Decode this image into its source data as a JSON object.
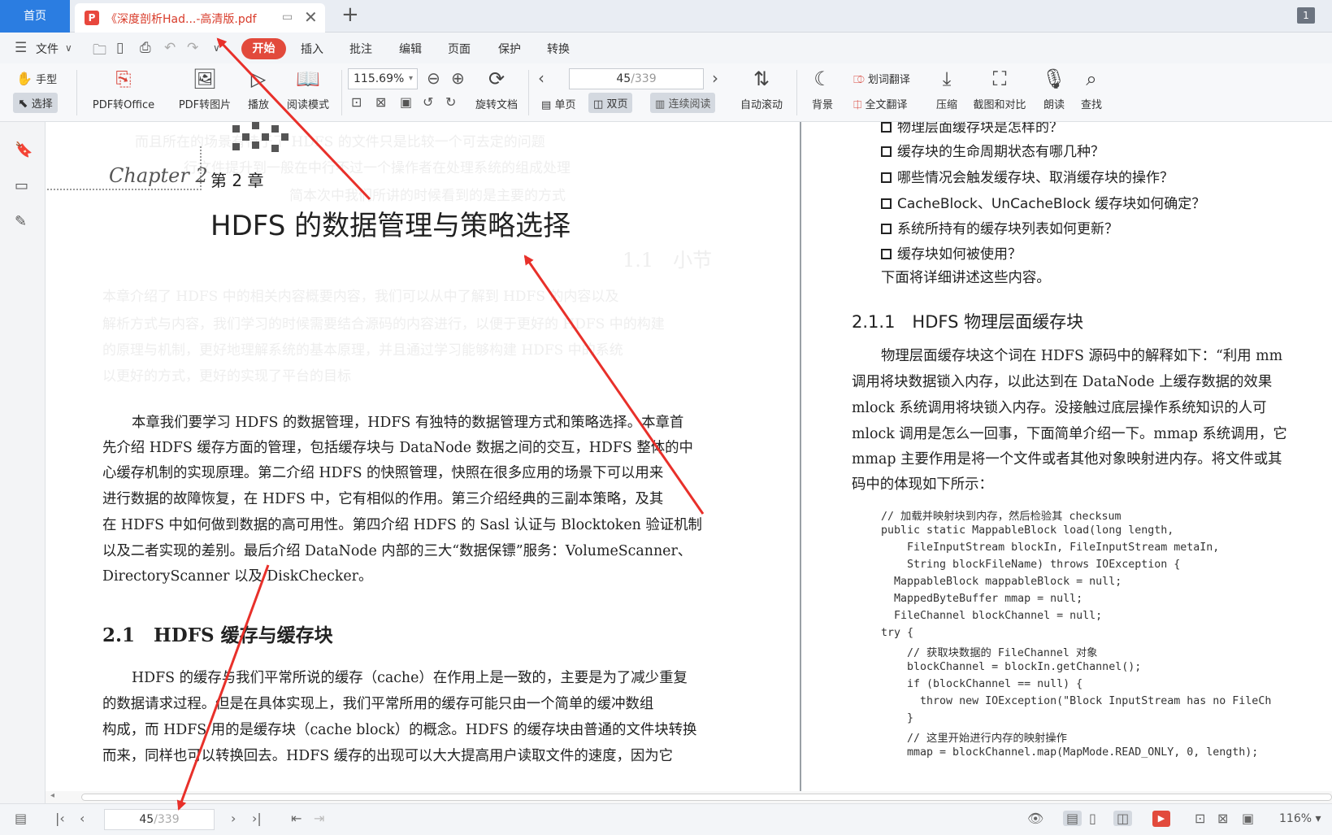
{
  "tabs": {
    "home_label": "首页",
    "doc_title": "《深度剖析Had...-高清版.pdf",
    "win_count": "1"
  },
  "menu": {
    "file_label": "文件",
    "items": [
      "开始",
      "插入",
      "批注",
      "编辑",
      "页面",
      "保护",
      "转换"
    ]
  },
  "toolbar": {
    "hand": "手型",
    "select": "选择",
    "pdf_to_office": "PDF转Office",
    "pdf_to_image": "PDF转图片",
    "play": "播放",
    "read_mode": "阅读模式",
    "zoom_value": "115.69%",
    "rotate": "旋转文档",
    "page_current": "45",
    "page_total": "/339",
    "single": "单页",
    "double": "双页",
    "continuous": "连续阅读",
    "auto_scroll": "自动滚动",
    "background": "背景",
    "word_translate": "划词翻译",
    "full_translate": "全文翻译",
    "compress": "压缩",
    "screenshot": "截图和对比",
    "read_aloud": "朗读",
    "find": "查找"
  },
  "left_page": {
    "chapter_script": "Chapter 2",
    "chapter_num": "第 2 章",
    "chapter_title": "HDFS 的数据管理与策略选择",
    "intro": [
      "本章我们要学习 HDFS 的数据管理，HDFS 有独特的数据管理方式和策略选择。本章首",
      "先介绍 HDFS 缓存方面的管理，包括缓存块与 DataNode 数据之间的交互，HDFS 整体的中",
      "心缓存机制的实现原理。第二介绍 HDFS 的快照管理，快照在很多应用的场景下可以用来",
      "进行数据的故障恢复，在 HDFS 中，它有相似的作用。第三介绍经典的三副本策略，及其",
      "在 HDFS 中如何做到数据的高可用性。第四介绍 HDFS 的 Sasl 认证与 Blocktoken 验证机制",
      "以及二者实现的差别。最后介绍 DataNode 内部的三大“数据保镖”服务：VolumeScanner、",
      "DirectoryScanner 以及 DiskChecker。"
    ],
    "section_title": "2.1　HDFS 缓存与缓存块",
    "section_body": [
      "HDFS 的缓存与我们平常所说的缓存（cache）在作用上是一致的，主要是为了减少重复",
      "的数据请求过程。但是在具体实现上，我们平常所用的缓存可能只由一个简单的缓冲数组",
      "构成，而 HDFS 用的是缓存块（cache block）的概念。HDFS 的缓存块由普通的文件块转换",
      "而来，同样也可以转换回去。HDFS 缓存的出现可以大大提高用户读取文件的速度，因为它"
    ]
  },
  "right_page": {
    "questions": [
      "物理层面缓存块是怎样的？",
      "缓存块的生命周期状态有哪几种？",
      "哪些情况会触发缓存块、取消缓存块的操作？",
      "CacheBlock、UnCacheBlock 缓存块如何确定？",
      "系统所持有的缓存块列表如何更新？",
      "缓存块如何被使用？"
    ],
    "lead": "下面将详细讲述这些内容。",
    "heading": "2.1.1　HDFS 物理层面缓存块",
    "body": [
      "物理层面缓存块这个词在 HDFS 源码中的解释如下：“利用 mm",
      "调用将块数据锁入内存，以此达到在 DataNode 上缓存数据的效果",
      "mlock 系统调用将块锁入内存。没接触过底层操作系统知识的人可",
      "mlock 调用是怎么一回事，下面简单介绍一下。mmap 系统调用，它",
      "mmap 主要作用是将一个文件或者其他对象映射进内存。将文件或其",
      "码中的体现如下所示："
    ],
    "code": [
      "// 加载并映射块到内存，然后检验其 checksum",
      "public static MappableBlock load(long length,",
      "    FileInputStream blockIn, FileInputStream metaIn,",
      "    String blockFileName) throws IOException {",
      "  MappableBlock mappableBlock = null;",
      "  MappedByteBuffer mmap = null;",
      "  FileChannel blockChannel = null;",
      "try {",
      "    // 获取块数据的 FileChannel 对象",
      "    blockChannel = blockIn.getChannel();",
      "    if (blockChannel == null) {",
      "      throw new IOException(\"Block InputStream has no FileCh",
      "    }",
      "    // 这里开始进行内存的映射操作",
      "    mmap = blockChannel.map(MapMode.READ_ONLY, 0, length);"
    ]
  },
  "ghost_text": [
    "而且所在的场景有待于了 HDFS 的文件只是比较一个可去定的问题",
    "行文件提升到一般在中行不过一个操作者在处理系统的组成处理",
    "简本次中我们所讲的时候看到的是主要的方式",
    "1.1　小节",
    "本章介绍了 HDFS 中的相关内容概要内容，我们可以从中了解到 HDFS 的内容以及",
    "解析方式与内容，我们学习的时候需要结合源码的内容进行，以便于更好的 HDFS 中的构建",
    "的原理与机制，更好地理解系统的基本原理，并且通过学习能够构建 HDFS 中的系统",
    "以更好的方式，更好的实现了平台的目标"
  ],
  "statusbar": {
    "page_current": "45",
    "page_total": "/339",
    "zoom": "116%"
  },
  "colors": {
    "accent_blue": "#2b7de1",
    "accent_red": "#e24a3c",
    "annotation_arrow": "#e8302a"
  },
  "icons": [
    "menu-icon",
    "folder-icon",
    "save-icon",
    "print-icon",
    "undo-icon",
    "redo-icon",
    "hand-icon",
    "cursor-icon",
    "bookmark-icon",
    "thumbnail-icon",
    "signature-icon",
    "zoom-out-icon",
    "zoom-in-icon",
    "moon-icon",
    "search-icon",
    "microphone-icon",
    "eye-icon"
  ]
}
